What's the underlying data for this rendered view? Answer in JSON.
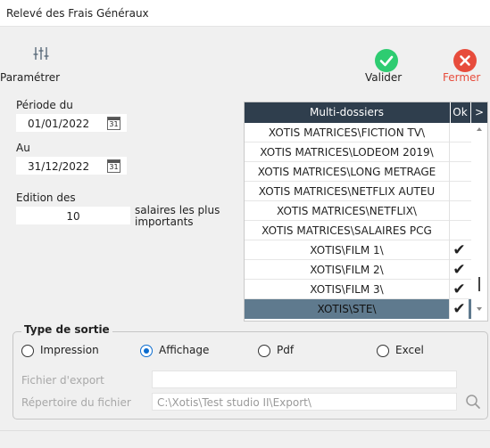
{
  "window": {
    "title": "Relevé des Frais Généraux"
  },
  "toolbar": {
    "settings_label": "Paramétrer",
    "validate_label": "Valider",
    "close_label": "Fermer"
  },
  "period": {
    "from_label": "Période du",
    "from_value": "01/01/2022",
    "to_label": "Au",
    "to_value": "31/12/2022",
    "calendar_icon_text": "31"
  },
  "edition": {
    "label": "Edition des",
    "value": "10",
    "suffix_line1": "salaires les plus",
    "suffix_line2": "importants"
  },
  "grid": {
    "header_main": "Multi-dossiers",
    "header_ok": "Ok",
    "header_arrow": ">",
    "rows": [
      {
        "name": "XOTIS MATRICES\\FICTION TV\\",
        "ok": ""
      },
      {
        "name": "XOTIS MATRICES\\LODEOM 2019\\",
        "ok": ""
      },
      {
        "name": "XOTIS MATRICES\\LONG METRAGE",
        "ok": ""
      },
      {
        "name": "XOTIS MATRICES\\NETFLIX AUTEU",
        "ok": ""
      },
      {
        "name": "XOTIS MATRICES\\NETFLIX\\",
        "ok": ""
      },
      {
        "name": "XOTIS MATRICES\\SALAIRES PCG",
        "ok": ""
      },
      {
        "name": "XOTIS\\FILM 1\\",
        "ok": "✔"
      },
      {
        "name": "XOTIS\\FILM 2\\",
        "ok": "✔"
      },
      {
        "name": "XOTIS\\FILM 3\\",
        "ok": "✔"
      },
      {
        "name": "XOTIS\\STE\\",
        "ok": "✔"
      }
    ],
    "selected_index": 9
  },
  "output": {
    "group_title": "Type de sortie",
    "options": [
      "Impression",
      "Affichage",
      "Pdf",
      "Excel"
    ],
    "selected": "Affichage",
    "export_file_label": "Fichier d'export",
    "export_file_value": "",
    "export_dir_label": "Répertoire du fichier",
    "export_dir_value": "C:\\Xotis\\Test studio II\\Export\\"
  },
  "colors": {
    "accent_green": "#2ecc71",
    "accent_red": "#e74c3c",
    "grid_header": "#2f3e4d",
    "selected_row": "#5f7a8e",
    "radio_blue": "#0b6ccf"
  },
  "icons": {
    "settings": "sliders-icon",
    "validate": "check-circle-icon",
    "close": "x-circle-icon",
    "calendar": "calendar-icon",
    "search": "search-icon"
  }
}
